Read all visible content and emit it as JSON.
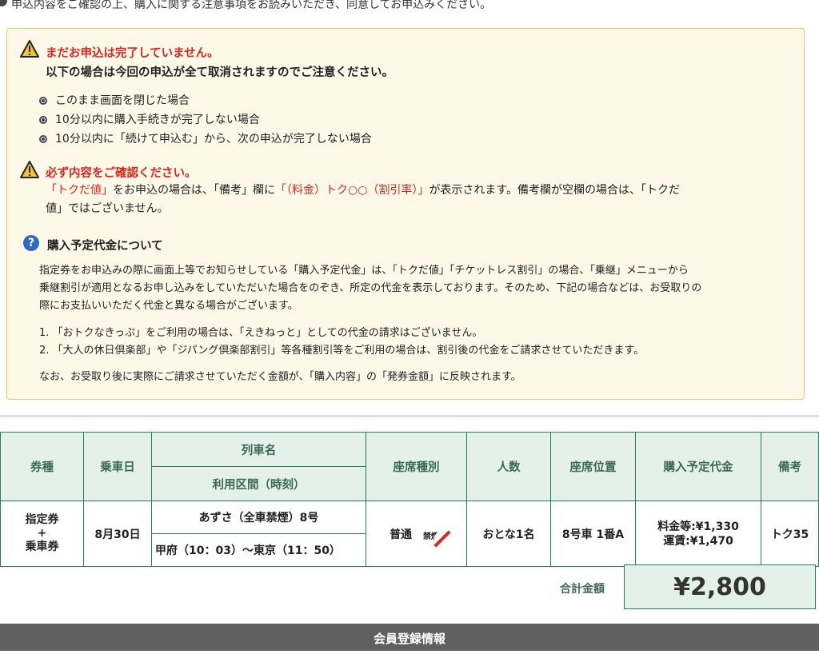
{
  "top_text": "申込内容をご確認の上、購入に関する注意事項をお読みいただき、同意してお申込みください。",
  "notice": {
    "warn1_title": "まだお申込は完了していません。",
    "warn1_sub": "以下の場合は今回の申込が全て取消されますのでご注意ください。",
    "cancel_items": [
      "このまま画面を閉じた場合",
      "10分以内に購入手続きが完了しない場合",
      "10分以内に「続けて申込む」から、次の申込が完了しない場合"
    ],
    "warn2_title": "必ず内容をご確認ください。",
    "warn2_part1": "「トクだ値」",
    "warn2_part2": "をお申込の場合は、「備考」欄に",
    "warn2_part3": "「（料金）トク○○（割引率）」",
    "warn2_part4": "が表示されます。備考欄が空欄の場合は、「トクだ",
    "warn2_line2": "値」ではございません。",
    "q_title": "購入予定代金について",
    "q_icon": "?",
    "q_para": [
      "指定券をお申込みの際に画面上等でお知らせしている「購入予定代金」は、「トクだ値」「チケットレス割引」の場合、「乗継」メニューから",
      "乗継割引が適用となるお申し込みをしていただいた場合をのぞき、所定の代金を表示しております。そのため、下記の場合などは、お受取りの",
      "際にお支払いいただく代金と異なる場合がございます。"
    ],
    "numbered": [
      "1.  「おトクなきっぷ」をご利用の場合は、「えきねっと」としての代金の請求はございません。",
      "2.  「大人の休日倶楽部」や「ジパング倶楽部割引」等各種割引等をご利用の場合は、割引後の代金をご請求させていただきます。"
    ],
    "closing": "なお、お受取り後に実際にご請求させていただく金額が、「購入内容」の「発券金額」に反映されます。"
  },
  "table": {
    "headers": {
      "ticket_type": "券種",
      "date": "乗車日",
      "train_name": "列車名",
      "section": "利用区間（時刻）",
      "seat_class": "座席種別",
      "people": "人数",
      "seat_pos": "座席位置",
      "price": "購入予定代金",
      "notes": "備考"
    },
    "row": {
      "ticket_type_1": "指定券",
      "ticket_type_2": "+",
      "ticket_type_3": "乗車券",
      "date": "8月30日",
      "train_name": "あずさ（全車禁煙）8号",
      "section": "甲府（10：03）～東京（11：50）",
      "seat_class": "普通",
      "nosmoke_label": "禁煙",
      "people": "おとな1名",
      "seat_pos": "8号車 1番A",
      "fee": "料金等:¥1,330",
      "fare": "運賃:¥1,470",
      "notes": "トク35"
    }
  },
  "total": {
    "label": "合計金額",
    "amount": "¥2,800"
  },
  "bottom_bar": "会員登録情報",
  "colors": {
    "warning_red": "#d9281e",
    "header_green_bg": "#e3f1ea",
    "border_green": "#2f7a55",
    "notice_bg": "#fdf8e8"
  }
}
